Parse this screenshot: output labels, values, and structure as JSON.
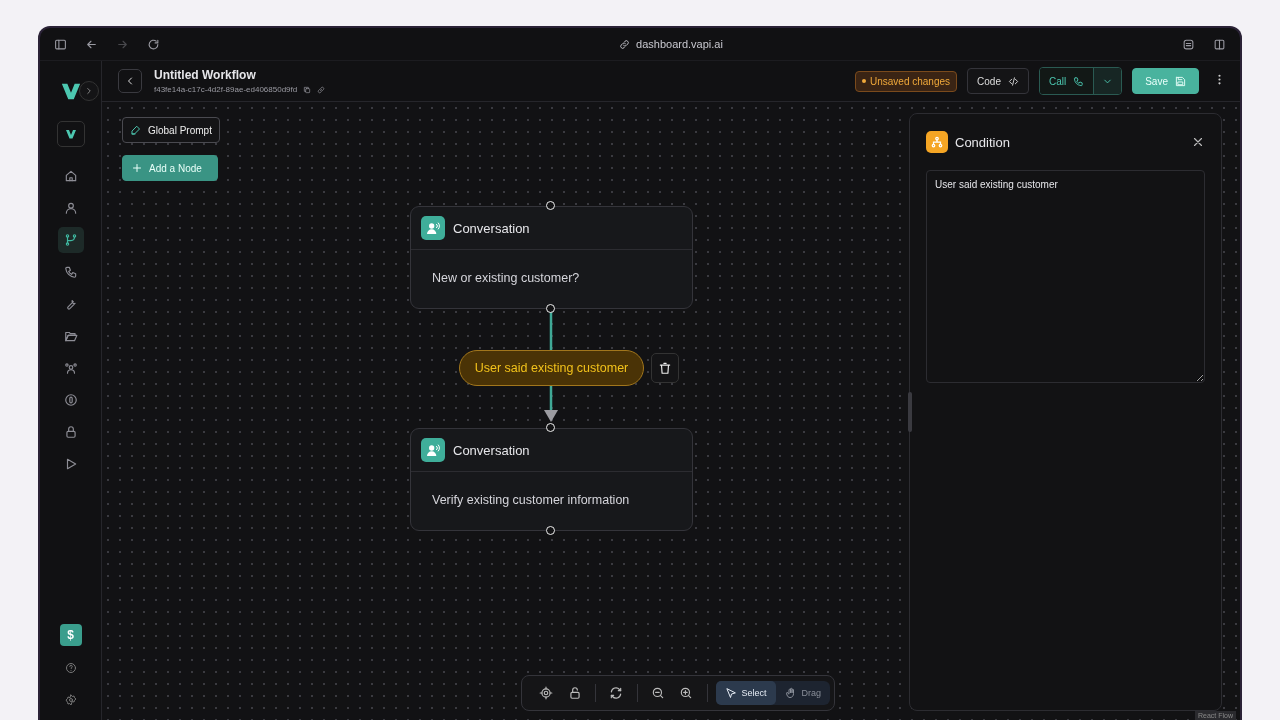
{
  "browser": {
    "url": "dashboard.vapi.ai"
  },
  "sidebar": {
    "items": [
      {
        "selected": false
      },
      {
        "selected": false
      },
      {
        "selected": true
      },
      {
        "selected": false
      },
      {
        "selected": false
      },
      {
        "selected": false
      },
      {
        "selected": false
      },
      {
        "selected": false
      },
      {
        "selected": false
      },
      {
        "selected": false
      }
    ],
    "credits": "$"
  },
  "header": {
    "title": "Untitled Workflow",
    "id": "f43fe14a-c17c-4d2f-89ae-ed406850d9fd",
    "status": "Unsaved changes",
    "code_button": "Code",
    "call_button": "Call",
    "save_button": "Save"
  },
  "canvas": {
    "global_prompt": "Global Prompt",
    "add_node": "Add a Node",
    "nodes": [
      {
        "type": "Conversation",
        "prompt": "New or existing customer?"
      },
      {
        "type": "Conversation",
        "prompt": "Verify existing customer information"
      }
    ],
    "edges": [
      {
        "label": "User said existing customer",
        "selected": true
      }
    ],
    "attribution": "React Flow"
  },
  "toolbar": {
    "modes": [
      {
        "label": "Select",
        "selected": true
      },
      {
        "label": "Drag",
        "selected": false
      }
    ]
  },
  "panel": {
    "title": "Condition",
    "value": "User said existing customer"
  }
}
